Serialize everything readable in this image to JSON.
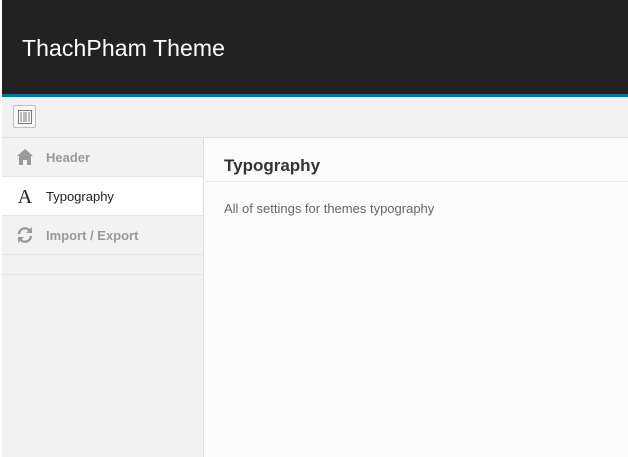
{
  "header": {
    "title": "ThachPham Theme"
  },
  "toolbar": {
    "toggle_icon": "layout-toggle-icon"
  },
  "sidebar": {
    "items": [
      {
        "label": "Header",
        "icon": "home-icon",
        "active": false
      },
      {
        "label": "Typography",
        "icon": "typography-icon",
        "active": true
      },
      {
        "label": "Import / Export",
        "icon": "refresh-icon",
        "active": false
      }
    ]
  },
  "content": {
    "title": "Typography",
    "description": "All of settings for themes typography"
  },
  "colors": {
    "header_bg": "#222222",
    "accent": "#0074a2",
    "sidebar_bg": "#f2f2f2",
    "active_item_bg": "#ffffff"
  }
}
